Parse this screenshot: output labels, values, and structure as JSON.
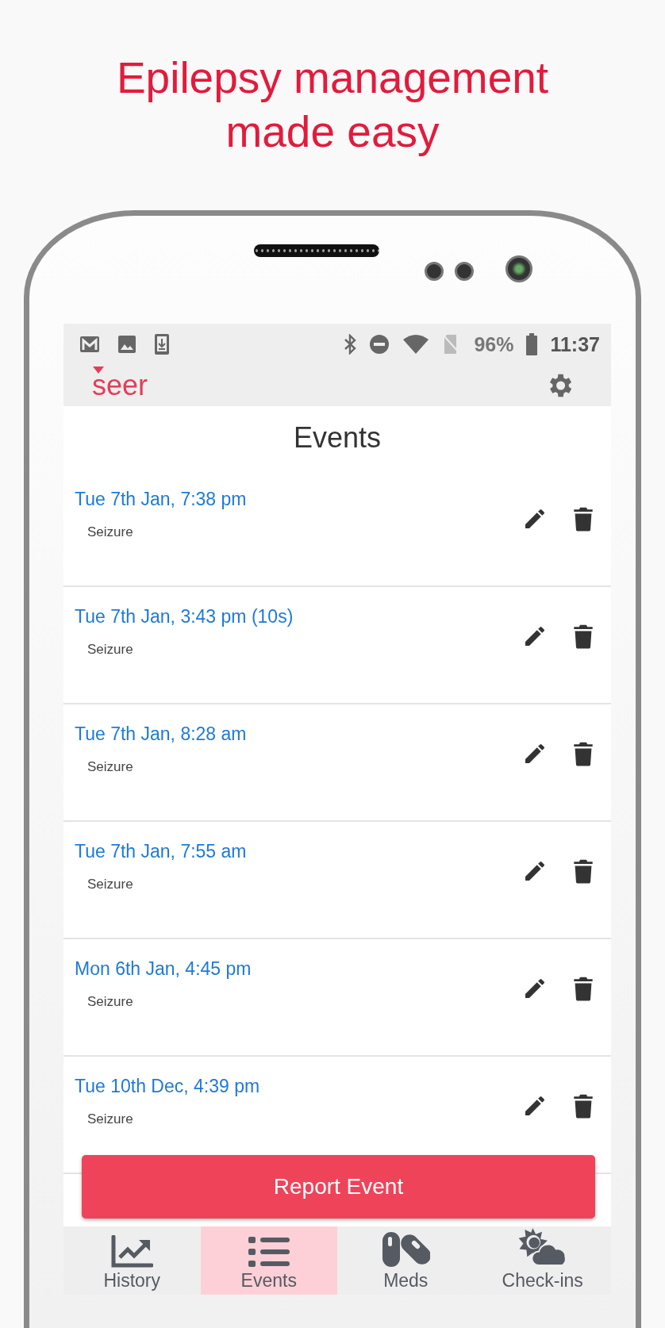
{
  "headline": "Epilepsy management made easy",
  "status_bar": {
    "battery": "96%",
    "time": "11:37"
  },
  "app_bar": {
    "logo": "seer"
  },
  "page_title": "Events",
  "events": [
    {
      "date": "Tue 7th Jan, 7:38 pm",
      "type": "Seizure"
    },
    {
      "date": "Tue 7th Jan, 3:43 pm (10s)",
      "type": "Seizure"
    },
    {
      "date": "Tue 7th Jan, 8:28 am",
      "type": "Seizure"
    },
    {
      "date": "Tue 7th Jan, 7:55 am",
      "type": "Seizure"
    },
    {
      "date": "Mon 6th Jan, 4:45 pm",
      "type": "Seizure"
    },
    {
      "date": "Tue 10th Dec, 4:39 pm",
      "type": "Seizure"
    }
  ],
  "report_button": "Report Event",
  "nav": [
    {
      "label": "History",
      "kind": "chart",
      "selected": false
    },
    {
      "label": "Events",
      "kind": "list",
      "selected": true
    },
    {
      "label": "Meds",
      "kind": "pills",
      "selected": false
    },
    {
      "label": "Check-ins",
      "kind": "weather",
      "selected": false
    }
  ]
}
